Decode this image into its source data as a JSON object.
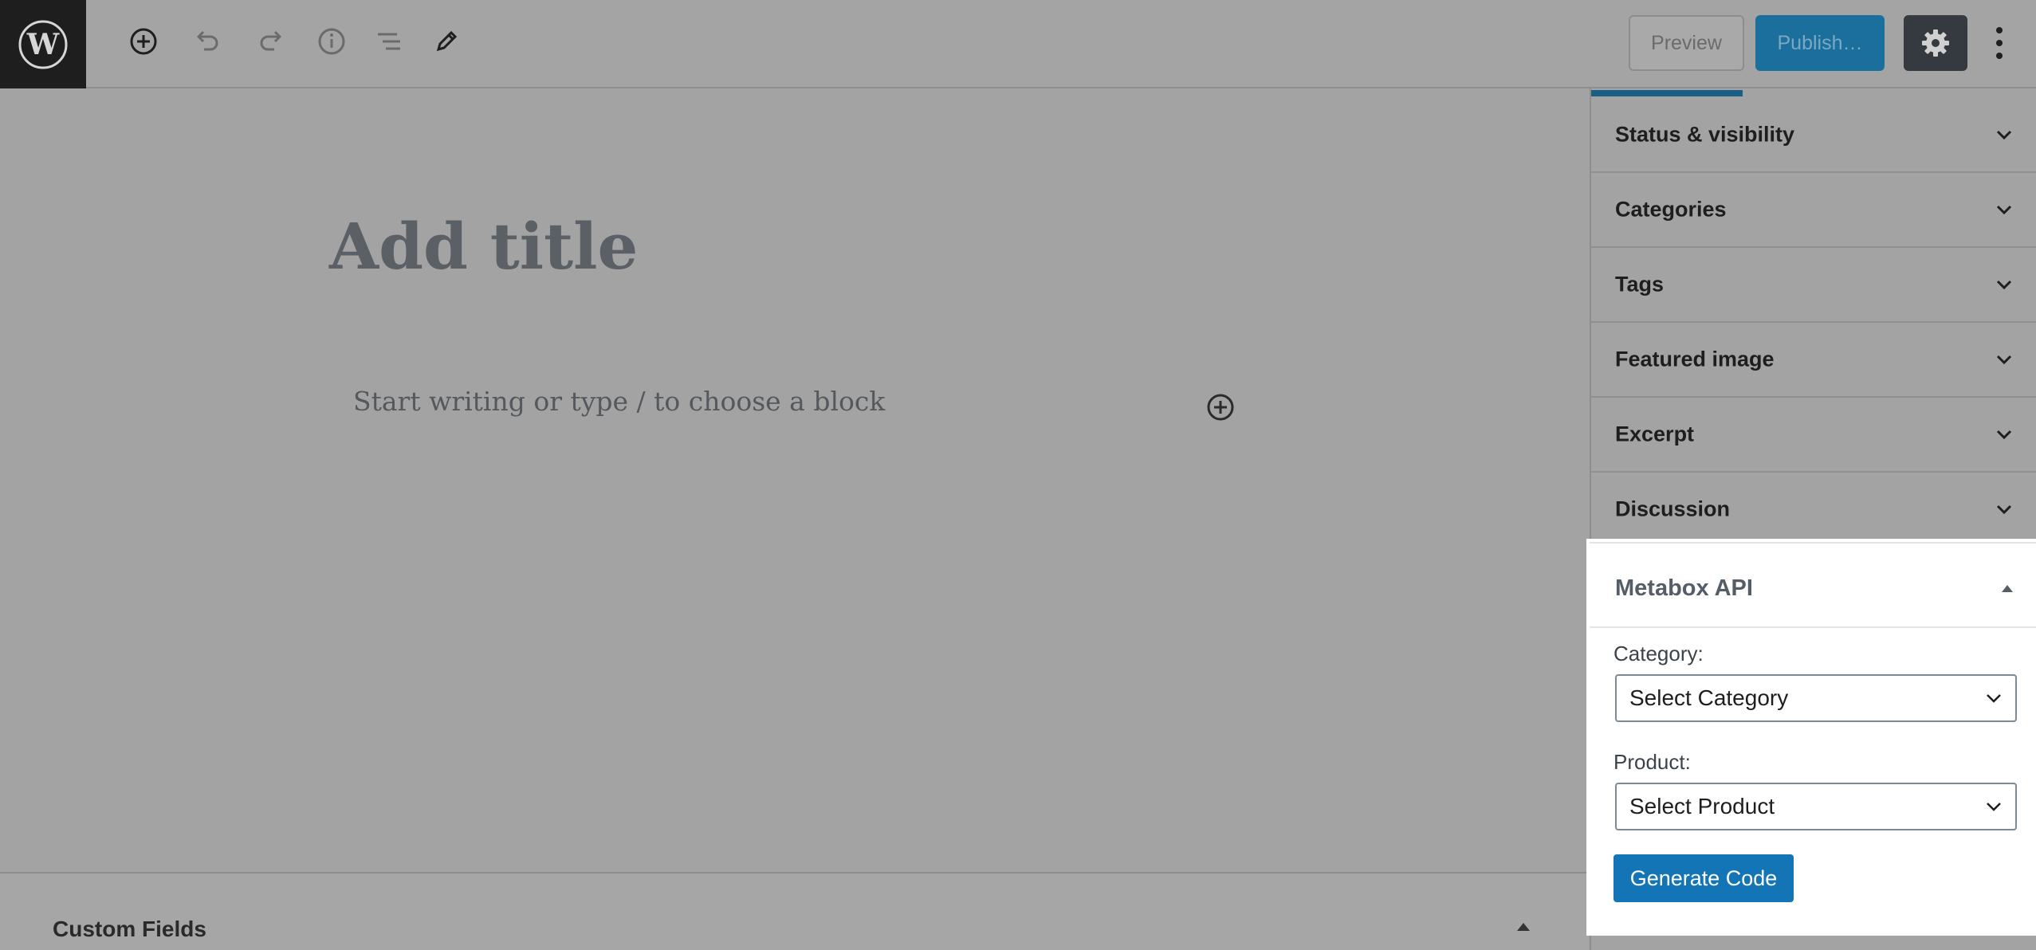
{
  "toolbar": {
    "icons": [
      "wordpress-logo",
      "add-block-icon",
      "undo-icon",
      "redo-icon",
      "info-icon",
      "block-navigation-icon",
      "edit-mode-icon"
    ],
    "preview_label": "Preview",
    "publish_label": "Publish…",
    "settings_icon": "gear-icon",
    "more_icon": "vertical-ellipsis-icon"
  },
  "editor": {
    "title_placeholder": "Add title",
    "block_placeholder": "Start writing or type / to choose a block"
  },
  "sidebar": {
    "panels": [
      {
        "label": "Status & visibility"
      },
      {
        "label": "Categories"
      },
      {
        "label": "Tags"
      },
      {
        "label": "Featured image"
      },
      {
        "label": "Excerpt"
      },
      {
        "label": "Discussion"
      }
    ],
    "metabox": {
      "title": "Metabox API",
      "category_label": "Category:",
      "category_value": "Select Category",
      "product_label": "Product:",
      "product_value": "Select Product",
      "generate_label": "Generate Code"
    }
  },
  "meta_boxes": {
    "custom_fields_title": "Custom Fields"
  },
  "colors": {
    "accent": "#1475b6",
    "overlay": "#a3a3a3",
    "dark": "#1e1e1e"
  }
}
